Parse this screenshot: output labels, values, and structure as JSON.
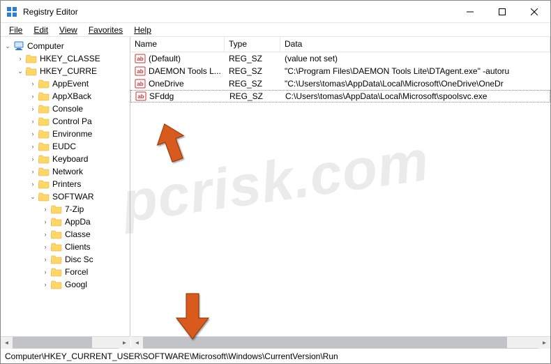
{
  "window": {
    "title": "Registry Editor"
  },
  "menu": {
    "file": "File",
    "edit": "Edit",
    "view": "View",
    "favorites": "Favorites",
    "help": "Help"
  },
  "tree": [
    {
      "level": 0,
      "expanded": true,
      "icon": "computer",
      "label": "Computer"
    },
    {
      "level": 1,
      "expanded": false,
      "icon": "folder",
      "label": "HKEY_CLASSE"
    },
    {
      "level": 1,
      "expanded": true,
      "icon": "folder",
      "label": "HKEY_CURRE"
    },
    {
      "level": 2,
      "expanded": false,
      "icon": "folder",
      "label": "AppEvent"
    },
    {
      "level": 2,
      "expanded": false,
      "icon": "folder",
      "label": "AppXBack"
    },
    {
      "level": 2,
      "expanded": false,
      "icon": "folder",
      "label": "Console"
    },
    {
      "level": 2,
      "expanded": false,
      "icon": "folder",
      "label": "Control Pa"
    },
    {
      "level": 2,
      "expanded": false,
      "icon": "folder",
      "label": "Environme"
    },
    {
      "level": 2,
      "expanded": false,
      "icon": "folder",
      "label": "EUDC"
    },
    {
      "level": 2,
      "expanded": false,
      "icon": "folder",
      "label": "Keyboard"
    },
    {
      "level": 2,
      "expanded": false,
      "icon": "folder",
      "label": "Network"
    },
    {
      "level": 2,
      "expanded": false,
      "icon": "folder",
      "label": "Printers"
    },
    {
      "level": 2,
      "expanded": true,
      "icon": "folder",
      "label": "SOFTWAR"
    },
    {
      "level": 3,
      "expanded": false,
      "icon": "folder",
      "label": "7-Zip"
    },
    {
      "level": 3,
      "expanded": false,
      "icon": "folder",
      "label": "AppDa"
    },
    {
      "level": 3,
      "expanded": false,
      "icon": "folder",
      "label": "Classe"
    },
    {
      "level": 3,
      "expanded": false,
      "icon": "folder",
      "label": "Clients"
    },
    {
      "level": 3,
      "expanded": false,
      "icon": "folder",
      "label": "Disc Sc"
    },
    {
      "level": 3,
      "expanded": false,
      "icon": "folder",
      "label": "Forcel"
    },
    {
      "level": 3,
      "expanded": false,
      "icon": "folder",
      "label": "Googl"
    }
  ],
  "list_header": {
    "name": "Name",
    "type": "Type",
    "data": "Data"
  },
  "values": [
    {
      "name": "(Default)",
      "type": "REG_SZ",
      "data": "(value not set)"
    },
    {
      "name": "DAEMON Tools L...",
      "type": "REG_SZ",
      "data": "\"C:\\Program Files\\DAEMON Tools Lite\\DTAgent.exe\" -autoru"
    },
    {
      "name": "OneDrive",
      "type": "REG_SZ",
      "data": "\"C:\\Users\\tomas\\AppData\\Local\\Microsoft\\OneDrive\\OneDr"
    },
    {
      "name": "SFddg",
      "type": "REG_SZ",
      "data": "C:\\Users\\tomas\\AppData\\Local\\Microsoft\\spoolsvc.exe",
      "focused": true
    }
  ],
  "path": "Computer\\HKEY_CURRENT_USER\\SOFTWARE\\Microsoft\\Windows\\CurrentVersion\\Run",
  "watermark": "pcrisk.com"
}
